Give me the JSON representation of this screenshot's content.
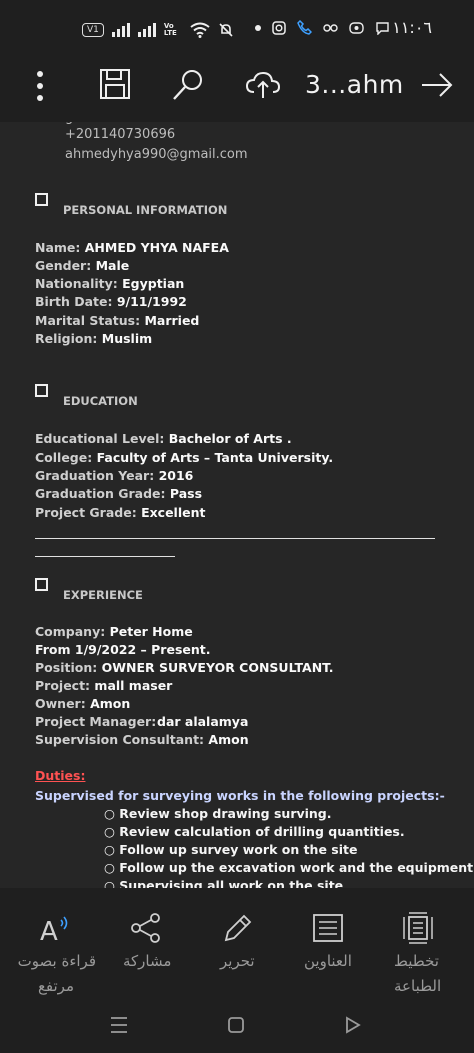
{
  "status_bar": {
    "sim_label": "V1",
    "network_label": "Vo LTE",
    "time": "١١:٠٦"
  },
  "toolbar": {
    "document_title": "3...ahm"
  },
  "contact": {
    "partial_line": "g",
    "phone": "+201140730696",
    "email": "ahmedyhya990@gmail.com"
  },
  "personal": {
    "title": "PERSONAL INFORMATION",
    "rows": [
      {
        "label": "Name: ",
        "value": "AHMED YHYA NAFEA"
      },
      {
        "label": "Gender: ",
        "value": "Male"
      },
      {
        "label": "Nationality: ",
        "value": "Egyptian"
      },
      {
        "label": "Birth Date: ",
        "value": "9/11/1992"
      },
      {
        "label": "Marital Status: ",
        "value": "Married"
      },
      {
        "label": "Religion: ",
        "value": "Muslim"
      }
    ]
  },
  "education": {
    "title": "EDUCATION",
    "rows": [
      {
        "label": "Educational Level: ",
        "value": "Bachelor of Arts ."
      },
      {
        "label": "College: ",
        "value": "Faculty of Arts – Tanta University."
      },
      {
        "label": "Graduation Year: ",
        "value": "2016"
      },
      {
        "label": "Graduation Grade: ",
        "value": "Pass"
      },
      {
        "label": "Project Grade: ",
        "value": "Excellent"
      }
    ]
  },
  "experience": {
    "title": "EXPERIENCE",
    "rows": [
      {
        "label": "Company: ",
        "value": "Peter Home"
      },
      {
        "label": "From  ",
        "value": "1/9/2022 – Present."
      },
      {
        "label": "Position: ",
        "value": "OWNER SURVEYOR CONSULTANT."
      },
      {
        "label": "Project: ",
        "value": "mall maser"
      },
      {
        "label": "Owner: ",
        "value": "Amon"
      },
      {
        "label": "Project Manager:",
        "value": "dar alalamya"
      },
      {
        "label": "Supervision Consultant: ",
        "value": "Amon"
      }
    ],
    "duties_label": "Duties:",
    "supervised_line": "Supervised for surveying works in the following projects:-",
    "bullets": [
      "○ Review shop drawing surving.",
      "○ Review calculation of drilling quantities.",
      "○ Follow up survey work on the site",
      "○ Follow up the excavation work and the equipment on the site",
      "○ Supervising all work on the site"
    ]
  },
  "bottom_bar": {
    "read_aloud_line1": "قراءة بصوت",
    "read_aloud_line2": "مرتفع",
    "share": "مشاركة",
    "edit": "تحرير",
    "headings": "العناوين",
    "layout_line1": "تخطيط",
    "layout_line2": "الطباعة"
  },
  "icons": {
    "menu": "more-vertical-icon",
    "save": "save-icon",
    "search": "search-icon",
    "cloud": "cloud-upload-icon",
    "arrow": "arrow-right-icon"
  }
}
